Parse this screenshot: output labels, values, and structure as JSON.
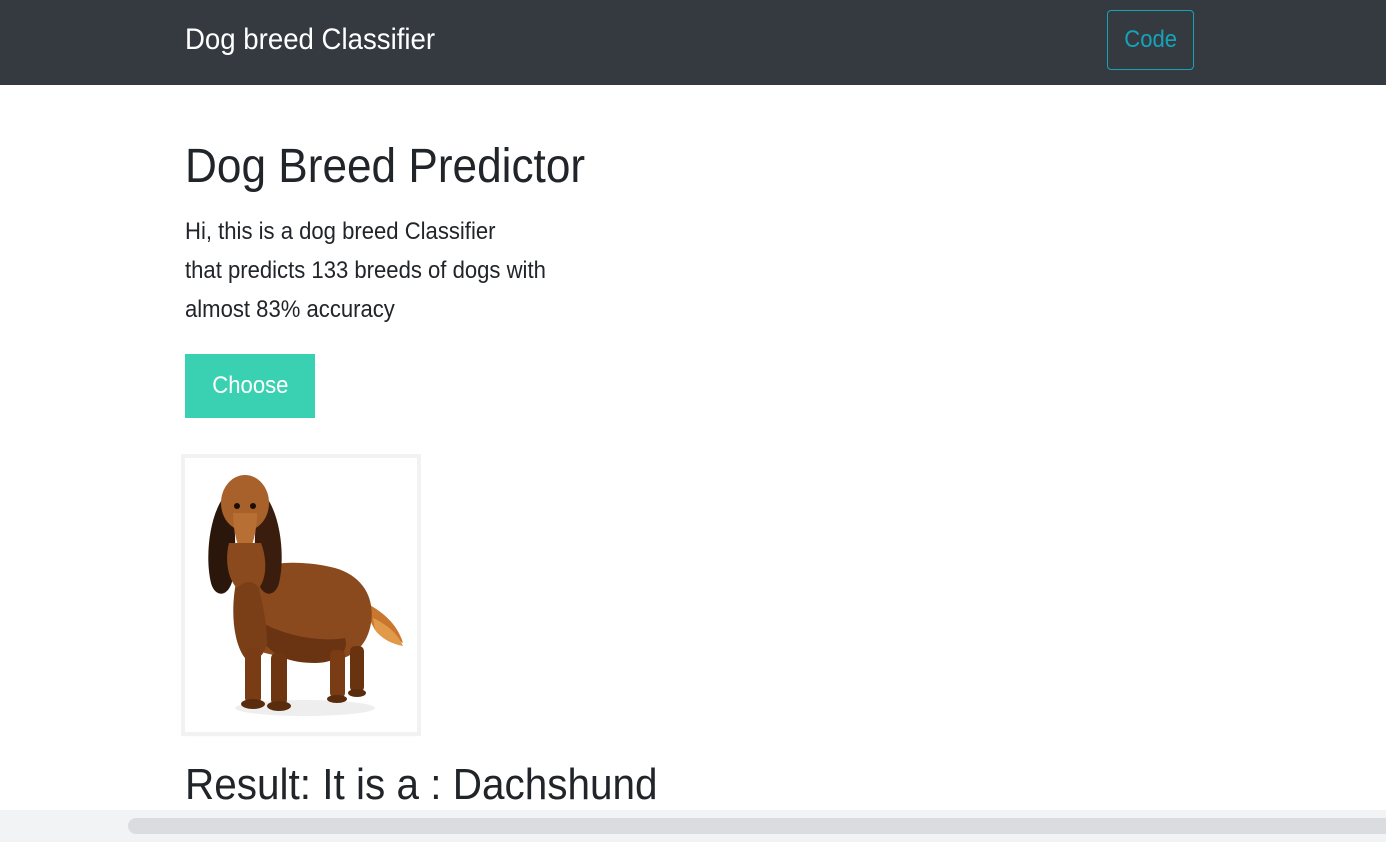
{
  "navbar": {
    "brand": "Dog breed Classifier",
    "code_button": "Code",
    "background_color": "#343a40",
    "accent_color": "#17a2b8"
  },
  "main": {
    "title": "Dog Breed Predictor",
    "description_lines": [
      "Hi, this is a dog breed Classifier",
      "that predicts 133 breeds of dogs with",
      "almost 83% accuracy"
    ],
    "choose_button": "Choose",
    "choose_button_color": "#3ad1b2",
    "uploaded_image_icon": "dog-photo",
    "result": "Result: It is a : Dachshund"
  }
}
